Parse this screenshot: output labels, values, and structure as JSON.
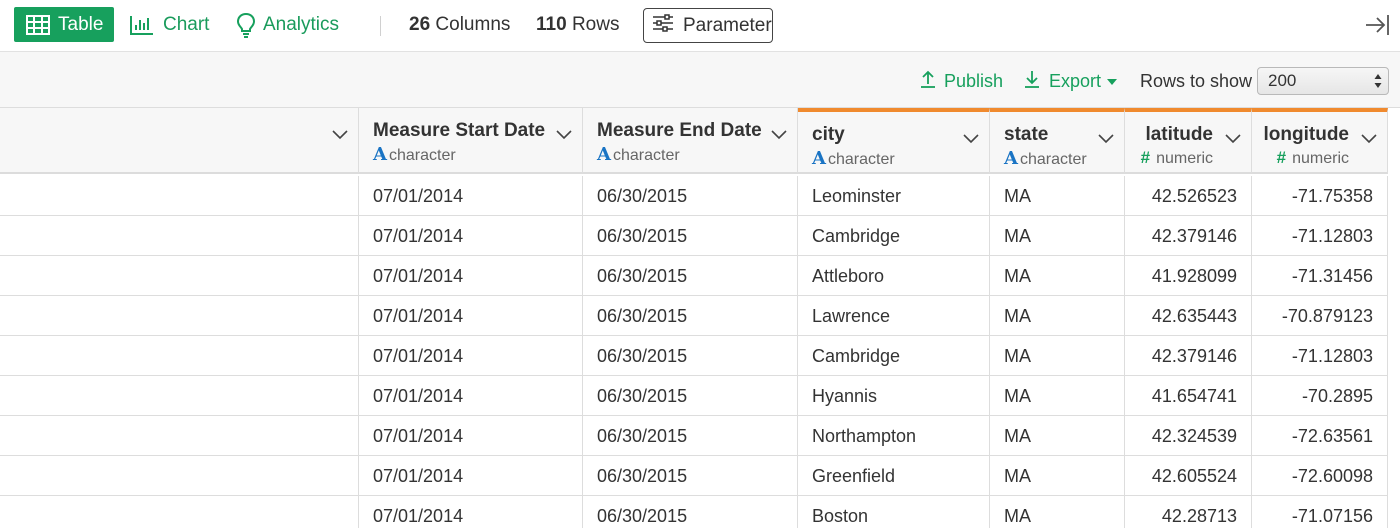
{
  "topbar": {
    "table_label": "Table",
    "chart_label": "Chart",
    "analytics_label": "Analytics",
    "columns_count": "26",
    "columns_label": "Columns",
    "rows_count": "110",
    "rows_label": "Rows",
    "parameter_label": "Parameter"
  },
  "toolbar": {
    "publish_label": "Publish",
    "export_label": "Export",
    "rows_to_show_label": "Rows to show",
    "rows_to_show_value": "200"
  },
  "colors": {
    "accent_green": "#17a05d",
    "highlight_orange": "#f08a2e",
    "character_blue": "#1a74c4"
  },
  "table": {
    "columns": [
      {
        "name": "",
        "type": "",
        "kind": "blank"
      },
      {
        "name": "Measure Start Date",
        "type": "character",
        "kind": "character"
      },
      {
        "name": "Measure End Date",
        "type": "character",
        "kind": "character"
      },
      {
        "name": "city",
        "type": "character",
        "kind": "character",
        "highlighted": true
      },
      {
        "name": "state",
        "type": "character",
        "kind": "character",
        "highlighted": true
      },
      {
        "name": "latitude",
        "type": "numeric",
        "kind": "numeric",
        "highlighted": true
      },
      {
        "name": "longitude",
        "type": "numeric",
        "kind": "numeric",
        "highlighted": true
      }
    ],
    "rows": [
      [
        "",
        "07/01/2014",
        "06/30/2015",
        "Leominster",
        "MA",
        "42.526523",
        "-71.75358"
      ],
      [
        "",
        "07/01/2014",
        "06/30/2015",
        "Cambridge",
        "MA",
        "42.379146",
        "-71.12803"
      ],
      [
        "",
        "07/01/2014",
        "06/30/2015",
        "Attleboro",
        "MA",
        "41.928099",
        "-71.31456"
      ],
      [
        "",
        "07/01/2014",
        "06/30/2015",
        "Lawrence",
        "MA",
        "42.635443",
        "-70.879123"
      ],
      [
        "",
        "07/01/2014",
        "06/30/2015",
        "Cambridge",
        "MA",
        "42.379146",
        "-71.12803"
      ],
      [
        "",
        "07/01/2014",
        "06/30/2015",
        "Hyannis",
        "MA",
        "41.654741",
        "-70.2895"
      ],
      [
        "",
        "07/01/2014",
        "06/30/2015",
        "Northampton",
        "MA",
        "42.324539",
        "-72.63561"
      ],
      [
        "",
        "07/01/2014",
        "06/30/2015",
        "Greenfield",
        "MA",
        "42.605524",
        "-72.60098"
      ],
      [
        "",
        "07/01/2014",
        "06/30/2015",
        "Boston",
        "MA",
        "42.28713",
        "-71.07156"
      ]
    ]
  }
}
